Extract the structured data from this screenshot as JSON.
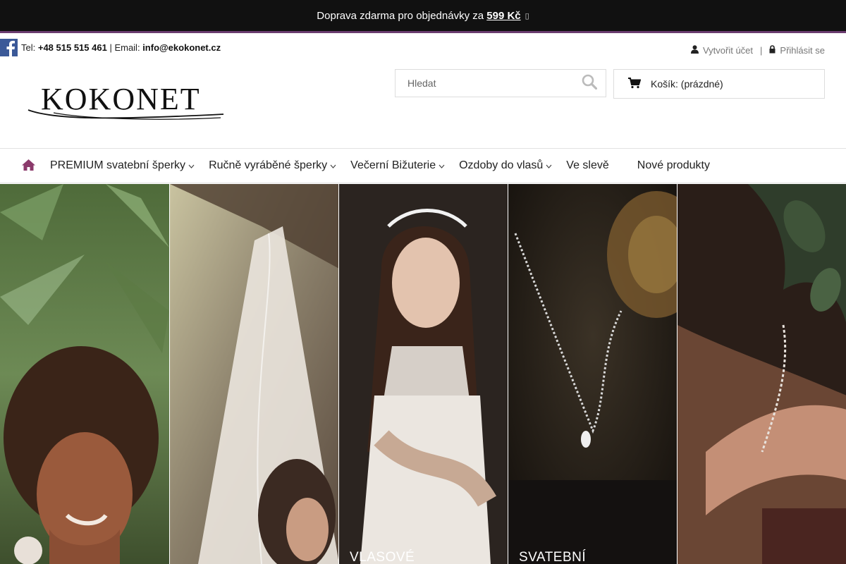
{
  "topbar": {
    "text": "Doprava zdarma pro objednávky za",
    "amount": "599 Kč",
    "icon": "truck-icon"
  },
  "contact": {
    "tel_label": "Tel:",
    "tel": "+48 515 515 461",
    "email_label": "| Email:",
    "email": "info@ekokonet.cz"
  },
  "account": {
    "create": "Vytvořit účet",
    "separator": "|",
    "login": "Přihlásit se"
  },
  "logo": {
    "text": "KOKONET"
  },
  "search": {
    "placeholder": "Hledat"
  },
  "cart": {
    "label": "Košík:",
    "status": "(prázdné)"
  },
  "nav": {
    "items": [
      {
        "label": "PREMIUM svatební šperky",
        "dropdown": true
      },
      {
        "label": "Ručně vyráběné šperky",
        "dropdown": true
      },
      {
        "label": "Večerní Bižuterie",
        "dropdown": true
      },
      {
        "label": "Ozdoby do vlasů",
        "dropdown": true
      },
      {
        "label": "Ve slevě",
        "dropdown": false
      },
      {
        "label": "Nové produkty",
        "dropdown": false
      }
    ]
  },
  "gallery": {
    "panels": [
      {
        "caption": ""
      },
      {
        "caption": ""
      },
      {
        "caption": "VLASOVÉ"
      },
      {
        "caption": "SVATEBNÍ"
      },
      {
        "caption": ""
      }
    ]
  },
  "colors": {
    "topbar_bg": "#111111",
    "accent_line": "#6b3c70",
    "facebook": "#3b5998",
    "home_icon": "#8b3a6b"
  }
}
